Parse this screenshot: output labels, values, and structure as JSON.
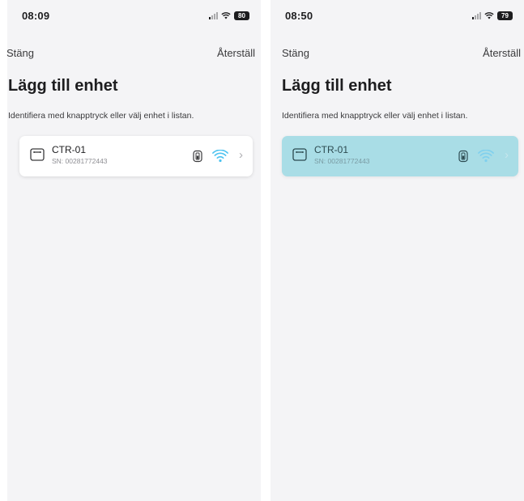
{
  "screens": [
    {
      "status": {
        "time": "08:09",
        "battery": "80"
      },
      "nav": {
        "close_label": "Stäng",
        "reset_label": "Återställ"
      },
      "title": "Lägg till enhet",
      "subtitle": "Identifiera med knapptryck eller välj enhet i listan.",
      "device": {
        "name": "CTR-01",
        "serial": "SN: 00281772443",
        "selected": false
      }
    },
    {
      "status": {
        "time": "08:50",
        "battery": "79"
      },
      "nav": {
        "close_label": "Stäng",
        "reset_label": "Återställ"
      },
      "title": "Lägg till enhet",
      "subtitle": "Identifiera med knapptryck eller välj enhet i listan.",
      "device": {
        "name": "CTR-01",
        "serial": "SN: 00281772443",
        "selected": true
      }
    }
  ],
  "colors": {
    "accent_wifi": "#4cc3f0",
    "selected_card": "#a9dde6",
    "background": "#f4f4f6"
  },
  "icons": [
    "signal-icon",
    "wifi-icon",
    "battery-icon",
    "device-icon",
    "battery-badge-icon",
    "chevron-right-icon"
  ]
}
